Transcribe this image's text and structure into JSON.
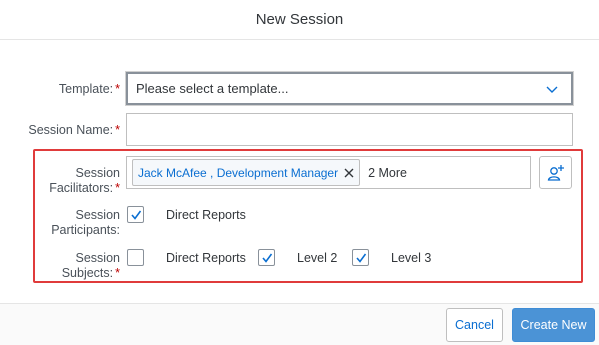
{
  "dialog": {
    "title": "New Session"
  },
  "form": {
    "template": {
      "label": "Template:",
      "required": "*",
      "value": "Please select a template..."
    },
    "session_name": {
      "label": "Session Name:",
      "required": "*",
      "value": ""
    },
    "facilitators": {
      "label_line1": "Session",
      "label_line2": "Facilitators:",
      "required": "*",
      "token": "Jack McAfee , Development Manager",
      "more": "2 More"
    },
    "participants": {
      "label_line1": "Session",
      "label_line2": "Participants:",
      "option": {
        "label": "Direct Reports",
        "checked": true
      }
    },
    "subjects": {
      "label_line1": "Session",
      "label_line2": "Subjects:",
      "required": "*",
      "options": [
        {
          "label": "Direct Reports",
          "checked": false
        },
        {
          "label": "Level 2",
          "checked": true
        },
        {
          "label": "Level 3",
          "checked": true
        }
      ]
    }
  },
  "footer": {
    "cancel": "Cancel",
    "create": "Create New"
  },
  "colors": {
    "accent": "#0a6ed1",
    "highlight": "#e03b3b",
    "required": "#bb0000"
  },
  "icons": [
    "chevron-down-icon",
    "close-icon",
    "add-person-icon",
    "checkmark-icon"
  ]
}
